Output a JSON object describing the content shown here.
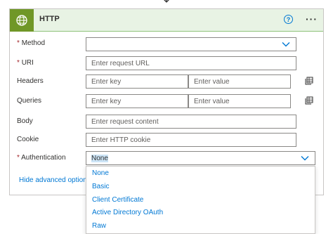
{
  "action": {
    "title": "HTTP",
    "help_icon": "?",
    "more_icon": "···",
    "accent_color": "#709727",
    "header_bg": "#e8f3e4"
  },
  "fields": {
    "method": {
      "label": "Method",
      "required": "*",
      "value": ""
    },
    "uri": {
      "label": "URI",
      "required": "*",
      "placeholder": "Enter request URL"
    },
    "headers": {
      "label": "Headers",
      "key_placeholder": "Enter key",
      "value_placeholder": "Enter value"
    },
    "queries": {
      "label": "Queries",
      "key_placeholder": "Enter key",
      "value_placeholder": "Enter value"
    },
    "body": {
      "label": "Body",
      "placeholder": "Enter request content"
    },
    "cookie": {
      "label": "Cookie",
      "placeholder": "Enter HTTP cookie"
    },
    "authentication": {
      "label": "Authentication",
      "required": "*",
      "value": "None"
    }
  },
  "advanced_link": "Hide advanced options",
  "auth_options": [
    "None",
    "Basic",
    "Client Certificate",
    "Active Directory OAuth",
    "Raw"
  ],
  "icons": {
    "action": "globe-icon",
    "dropdown": "chevron-down-icon",
    "switch_mode": "table-switch-icon"
  },
  "colors": {
    "link": "#0078d4",
    "required": "#a4262c",
    "selection": "#cce4f6"
  }
}
